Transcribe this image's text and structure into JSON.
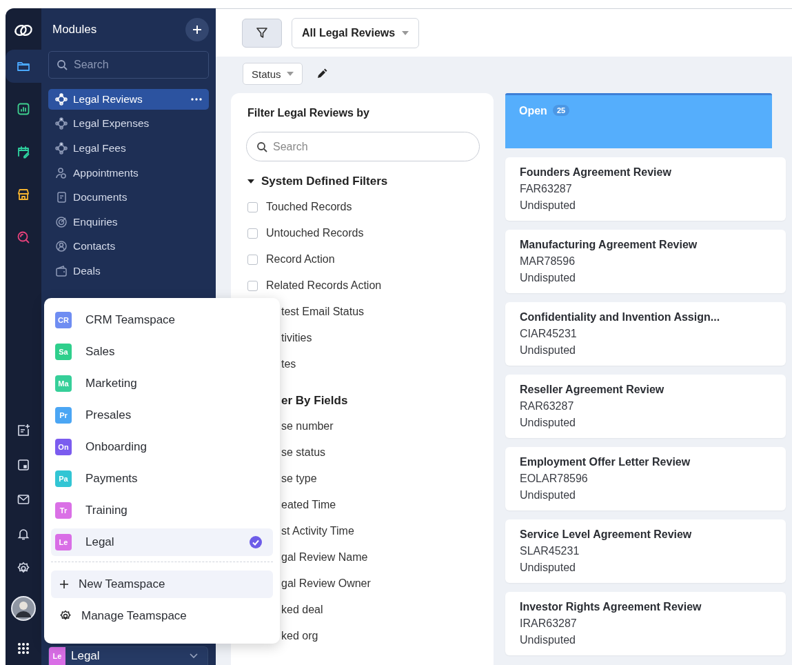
{
  "rail": {
    "apps": [
      {
        "selected": true
      },
      {
        "selected": false
      },
      {
        "selected": false
      },
      {
        "selected": false
      },
      {
        "selected": false
      }
    ]
  },
  "sidebar": {
    "title": "Modules",
    "search": {
      "placeholder": "Search"
    },
    "items": [
      {
        "label": "Legal Reviews",
        "selected": true
      },
      {
        "label": "Legal Expenses",
        "selected": false
      },
      {
        "label": "Legal Fees",
        "selected": false
      },
      {
        "label": "Appointments",
        "selected": false
      },
      {
        "label": "Documents",
        "selected": false
      },
      {
        "label": "Enquiries",
        "selected": false
      },
      {
        "label": "Contacts",
        "selected": false
      },
      {
        "label": "Deals",
        "selected": false
      }
    ],
    "teamspace": {
      "abbr": "Le",
      "name": "Legal",
      "color": "#d96ee6"
    }
  },
  "toolbar": {
    "view": "All Legal Reviews",
    "group_by": "Status"
  },
  "filter_panel": {
    "title": "Filter Legal Reviews by",
    "search": {
      "placeholder": "Search"
    },
    "sections": [
      {
        "kind": "heading",
        "title": "System Defined Filters",
        "expanded": true,
        "items": [
          {
            "kind": "checkbox",
            "label": "Touched Records",
            "checked": false
          },
          {
            "kind": "checkbox",
            "label": "Untouched Records",
            "checked": false
          },
          {
            "kind": "checkbox",
            "label": "Record Action",
            "checked": false
          },
          {
            "kind": "checkbox",
            "label": "Related Records Action",
            "checked": false
          },
          {
            "kind": "clipped",
            "label": "test Email Status"
          },
          {
            "kind": "clipped",
            "label": "tivities"
          },
          {
            "kind": "clipped",
            "label": "tes"
          }
        ]
      },
      {
        "kind": "clipped",
        "title": "er By Fields",
        "items": [
          {
            "kind": "clipped",
            "label": "se number"
          },
          {
            "kind": "clipped",
            "label": "se status"
          },
          {
            "kind": "clipped",
            "label": "se type"
          },
          {
            "kind": "clipped",
            "label": "eated Time"
          },
          {
            "kind": "clipped",
            "label": "st Activity Time"
          },
          {
            "kind": "clipped",
            "label": "gal Review Name"
          },
          {
            "kind": "clipped",
            "label": "gal Review Owner"
          },
          {
            "kind": "clipped",
            "label": "ked deal"
          },
          {
            "kind": "clipped",
            "label": "ked org"
          }
        ]
      }
    ]
  },
  "board": {
    "columns": [
      {
        "title": "Open",
        "count": "25",
        "color": "#55aefc",
        "cards": [
          {
            "title": "Founders Agreement Review",
            "code": "FAR63287",
            "status": "Undisputed"
          },
          {
            "title": "Manufacturing Agreement Review",
            "code": "MAR78596",
            "status": "Undisputed"
          },
          {
            "title": "Confidentiality and Invention Assign...",
            "code": "CIAR45231",
            "status": "Undisputed"
          },
          {
            "title": "Reseller Agreement Review",
            "code": "RAR63287",
            "status": "Undisputed"
          },
          {
            "title": "Employment Offer Letter Review",
            "code": "EOLAR78596",
            "status": "Undisputed"
          },
          {
            "title": "Service Level Agreement Review",
            "code": "SLAR45231",
            "status": "Undisputed"
          },
          {
            "title": "Investor Rights Agreement Review",
            "code": "IRAR63287",
            "status": "Undisputed"
          }
        ]
      }
    ]
  },
  "teamspace_menu": {
    "items": [
      {
        "abbr": "CR",
        "name": "CRM Teamspace",
        "color": "#6f8df2",
        "selected": false
      },
      {
        "abbr": "Sa",
        "name": "Sales",
        "color": "#2fcf8c",
        "selected": false
      },
      {
        "abbr": "Ma",
        "name": "Marketing",
        "color": "#36cf99",
        "selected": false
      },
      {
        "abbr": "Pr",
        "name": "Presales",
        "color": "#4ba6f4",
        "selected": false
      },
      {
        "abbr": "On",
        "name": "Onboarding",
        "color": "#7b5cef",
        "selected": false
      },
      {
        "abbr": "Pa",
        "name": "Payments",
        "color": "#32c5d4",
        "selected": false
      },
      {
        "abbr": "Tr",
        "name": "Training",
        "color": "#da70e6",
        "selected": false
      },
      {
        "abbr": "Le",
        "name": "Legal",
        "color": "#d96ee6",
        "selected": true
      }
    ],
    "actions": [
      {
        "kind": "new",
        "label": "New Teamspace",
        "hovered": true
      },
      {
        "kind": "manage",
        "label": "Manage Teamspace",
        "hovered": false
      }
    ]
  }
}
